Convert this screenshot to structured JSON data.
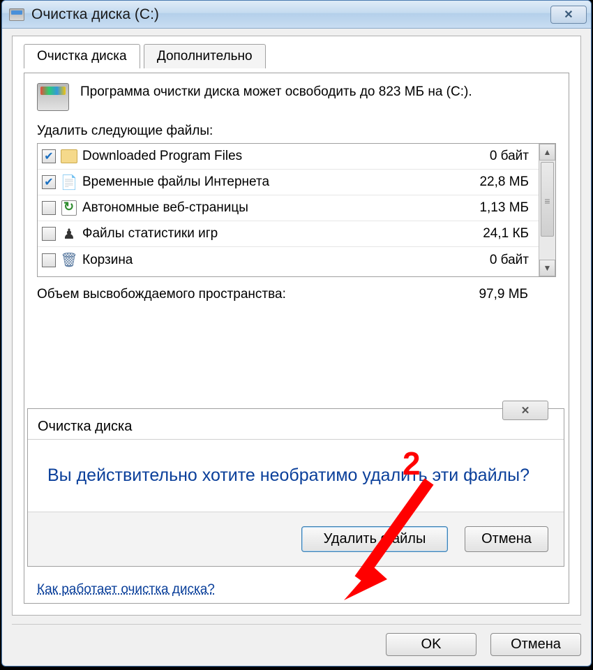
{
  "window": {
    "title": "Очистка диска  (C:)"
  },
  "tabs": {
    "active": "Очистка диска",
    "other": "Дополнительно"
  },
  "summary": "Программа очистки диска может освободить до 823 МБ на  (C:).",
  "list_label": "Удалить следующие файлы:",
  "files": [
    {
      "checked": true,
      "icon": "folder",
      "name": "Downloaded Program Files",
      "size": "0 байт"
    },
    {
      "checked": true,
      "icon": "ie",
      "name": "Временные файлы Интернета",
      "size": "22,8 МБ"
    },
    {
      "checked": false,
      "icon": "web",
      "name": "Автономные веб-страницы",
      "size": "1,13 МБ"
    },
    {
      "checked": false,
      "icon": "games",
      "name": "Файлы статистики игр",
      "size": "24,1 КБ"
    },
    {
      "checked": false,
      "icon": "recycle",
      "name": "Корзина",
      "size": "0 байт"
    }
  ],
  "total": {
    "label": "Объем высвобождаемого пространства:",
    "value": "97,9 МБ"
  },
  "confirm": {
    "title": "Очистка диска",
    "message": "Вы действительно хотите необратимо удалить эти файлы?",
    "delete": "Удалить файлы",
    "cancel": "Отмена"
  },
  "help_link": "Как работает очистка диска?",
  "buttons": {
    "ok": "OK",
    "cancel": "Отмена"
  },
  "annotation": {
    "num": "2"
  }
}
